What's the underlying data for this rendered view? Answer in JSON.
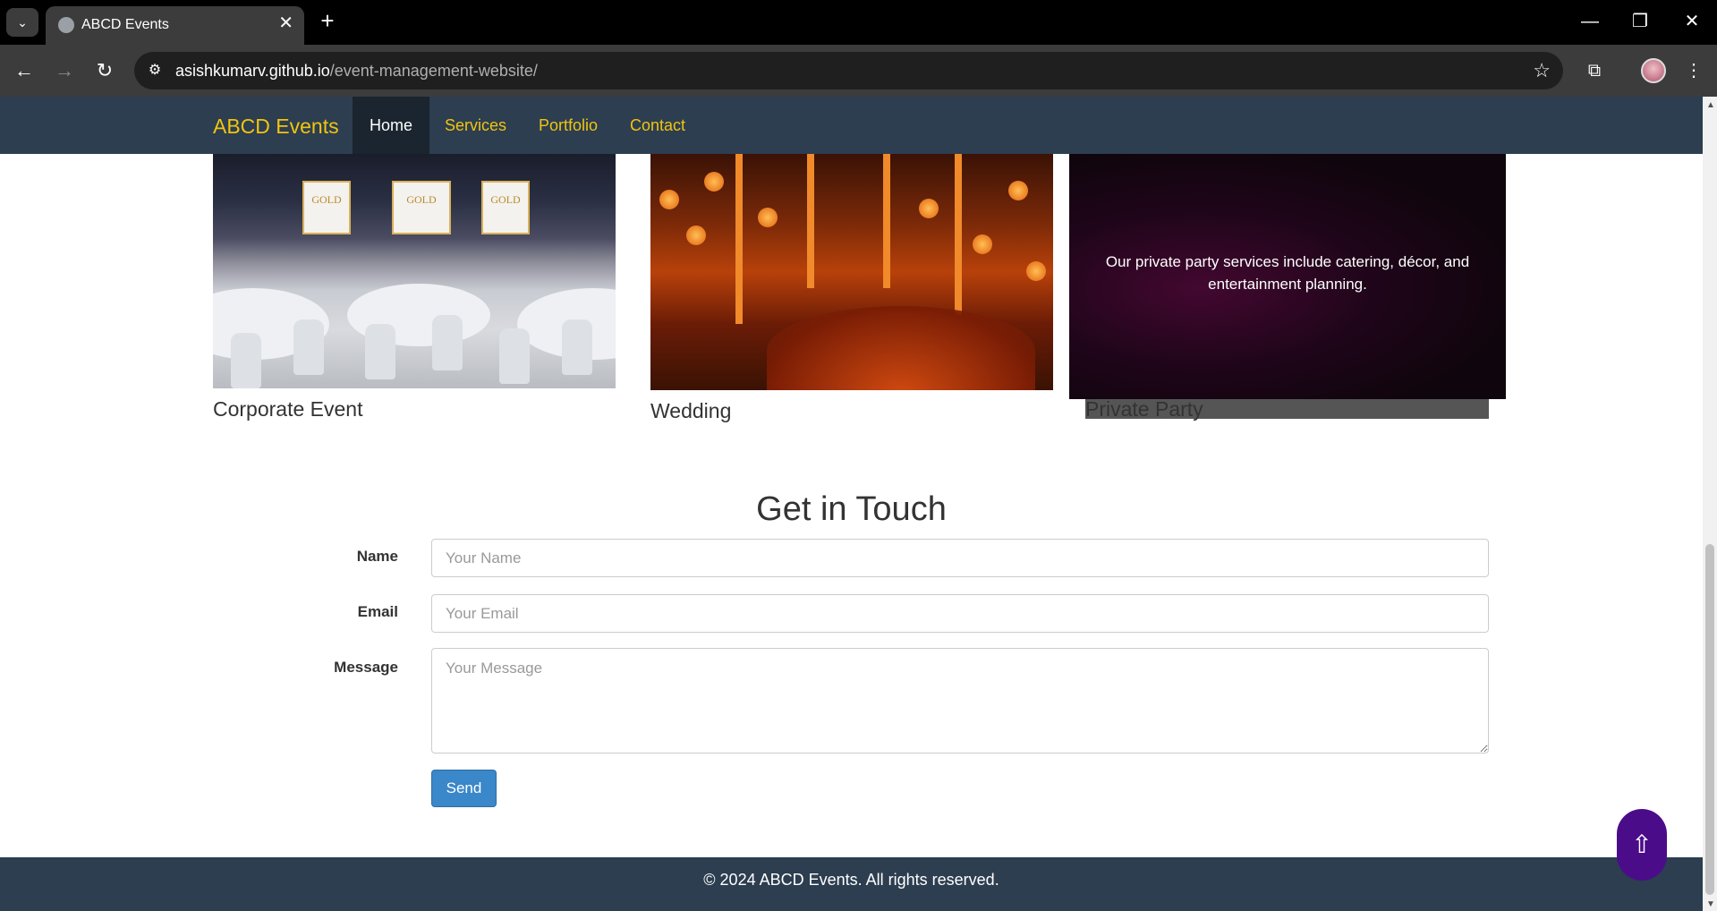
{
  "browser": {
    "tab_title": "ABCD Events",
    "url_host": "asishkumarv.github.io",
    "url_path": "/event-management-website/",
    "tab_close": "✕",
    "new_tab": "+",
    "win_minimize": "—",
    "win_restore": "❐",
    "win_close": "✕"
  },
  "navbar": {
    "brand": "ABCD Events",
    "items": [
      {
        "label": "Home",
        "active": true
      },
      {
        "label": "Services"
      },
      {
        "label": "Portfolio"
      },
      {
        "label": "Contact"
      }
    ]
  },
  "portfolio": {
    "cards": [
      {
        "caption": "Corporate Event",
        "screen_text": "GOLD"
      },
      {
        "caption": "Wedding"
      },
      {
        "caption": "Private Party",
        "overlay_text": "Our private party services include catering, décor, and entertainment planning."
      }
    ]
  },
  "contact": {
    "title": "Get in Touch",
    "name_label": "Name",
    "name_placeholder": "Your Name",
    "email_label": "Email",
    "email_placeholder": "Your Email",
    "message_label": "Message",
    "message_placeholder": "Your Message",
    "send_label": "Send"
  },
  "footer": {
    "text": "© 2024 ABCD Events. All rights reserved."
  },
  "back_to_top": "⇧",
  "colors": {
    "navbar_bg": "#2c3e50",
    "brand": "#f1c40f",
    "send_button": "#3a87c9",
    "back_to_top": "#4b0c8a"
  }
}
